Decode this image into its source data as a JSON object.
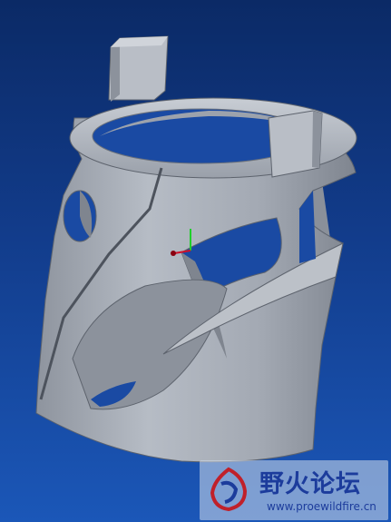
{
  "viewport": {
    "background_top": "#0b2a66",
    "background_bottom": "#1b57b8",
    "model_color": "#a9afb8",
    "model_shadow_color": "#6f7681"
  },
  "triad": {
    "x_axis_color": "#d0102a",
    "y_axis_color": "#1fd02a",
    "origin_color": "#8a0010"
  },
  "watermark": {
    "title": "野火论坛",
    "url": "www.proewildfire.cn",
    "logo_icon": "flame-dragon-logo"
  }
}
